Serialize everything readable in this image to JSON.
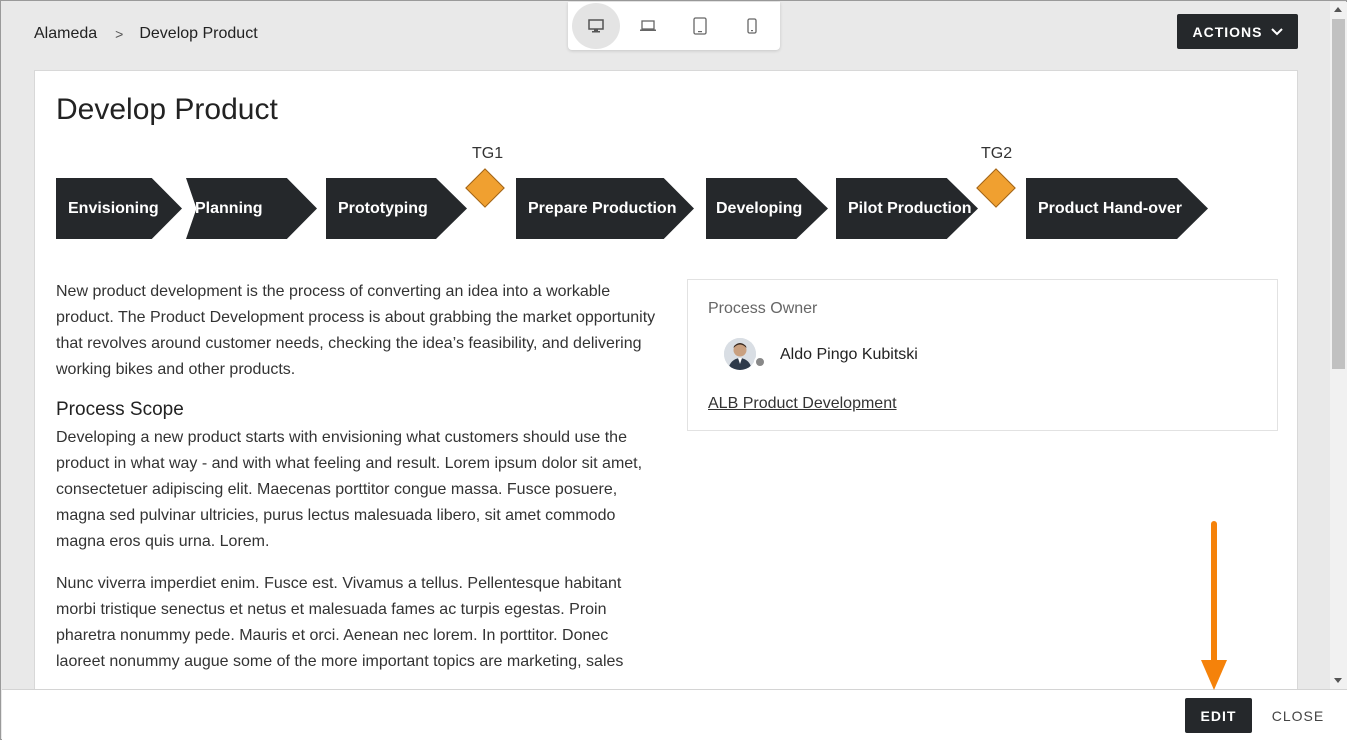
{
  "breadcrumb": {
    "root": "Alameda",
    "separator": ">",
    "current": "Develop Product"
  },
  "device_switcher": {
    "items": [
      {
        "name": "desktop-icon",
        "active": true
      },
      {
        "name": "laptop-icon",
        "active": false
      },
      {
        "name": "tablet-icon",
        "active": false
      },
      {
        "name": "phone-icon",
        "active": false
      }
    ]
  },
  "toolbar": {
    "actions_label": "ACTIONS"
  },
  "page": {
    "title": "Develop Product"
  },
  "process": {
    "steps": [
      "Envisioning",
      "Planning",
      "Prototyping",
      "Prepare Production",
      "Developing",
      "Pilot Production",
      "Product Hand-over"
    ],
    "gates": [
      "TG1",
      "TG2"
    ],
    "gate_color": "#f0a030",
    "step_color": "#25282b"
  },
  "description": {
    "intro": "New product development is the process of converting an idea into a workable product. The Product Development process is about grabbing the market opportunity that revolves around customer needs, checking the idea’s feasibility, and delivering working bikes and other products.",
    "scope_heading": "Process Scope",
    "scope_text": "Developing a new product starts with envisioning what customers should use the product in what way - and with what feeling and result. Lorem ipsum dolor sit amet, consectetuer adipiscing elit. Maecenas porttitor congue massa. Fusce posuere, magna sed pulvinar ultricies, purus lectus malesuada libero, sit amet commodo magna eros quis urna. Lorem.",
    "extra_text": "Nunc viverra imperdiet enim. Fusce est. Vivamus a tellus. Pellentesque habitant morbi tristique senectus et netus et malesuada fames ac turpis egestas. Proin pharetra nonummy pede. Mauris et orci. Aenean nec lorem. In porttitor. Donec laoreet nonummy augue some of the more important topics are marketing, sales"
  },
  "owner": {
    "label": "Process Owner",
    "name": "Aldo Pingo Kubitski",
    "org_link": "ALB Product Development"
  },
  "footer": {
    "edit_label": "EDIT",
    "close_label": "CLOSE"
  },
  "annotation": {
    "arrow_color": "#f5820a"
  }
}
